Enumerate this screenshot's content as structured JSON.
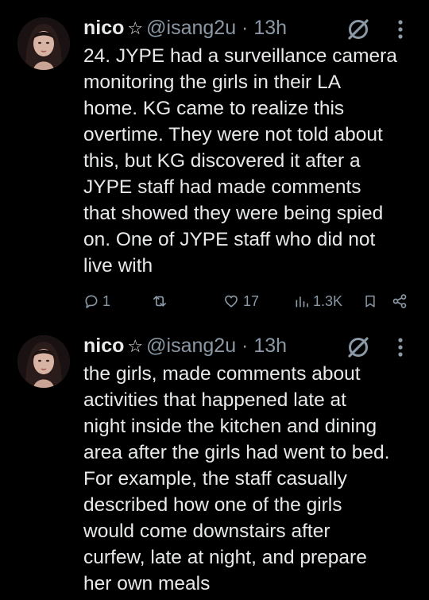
{
  "tweets": [
    {
      "author": {
        "name": "nico",
        "star": "☆",
        "handle": "@isang2u",
        "separator": "·",
        "time": "13h"
      },
      "text": "24. JYPE had a surveillance camera\nmonitoring the girls in their LA\nhome. KG came to realize this\novertime. They were not told about\nthis, but KG discovered it after a\nJYPE staff had made comments\nthat showed they were being spied\non. One of JYPE staff who did not\nlive with",
      "actions": {
        "replies": "1",
        "retweets": "",
        "likes": "17",
        "views": "1.3K"
      }
    },
    {
      "author": {
        "name": "nico",
        "star": "☆",
        "handle": "@isang2u",
        "separator": "·",
        "time": "13h"
      },
      "text": "the girls, made comments about\nactivities that happened late at\nnight inside the kitchen and dining\narea after the girls had went to bed.\nFor example, the staff casually\ndescribed how one of the girls\nwould come downstairs after\ncurfew, late at night, and prepare\nher own meals"
    }
  ],
  "icons": {
    "grok": "grok-icon",
    "more": "more-icon",
    "reply": "reply-icon",
    "retweet": "retweet-icon",
    "like": "heart-icon",
    "views": "views-icon",
    "bookmark": "bookmark-icon",
    "share": "share-icon"
  },
  "colors": {
    "background": "#000000",
    "text": "#e7e9ea",
    "secondary": "#8b98a5"
  }
}
